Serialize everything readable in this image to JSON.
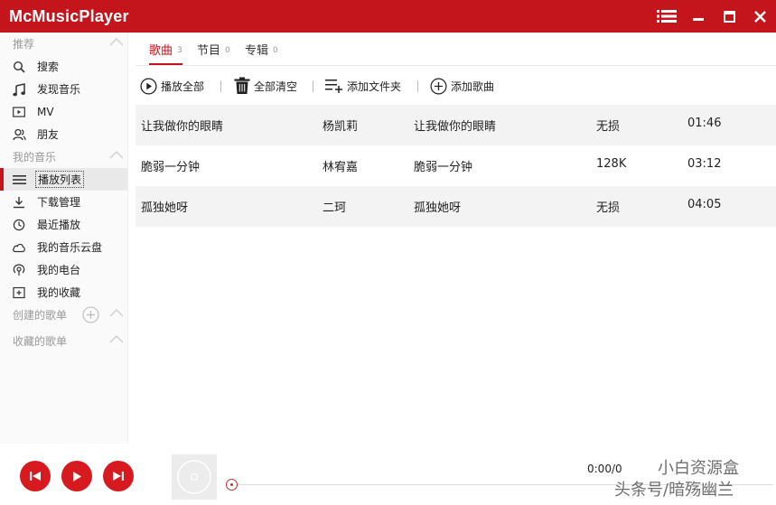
{
  "app": {
    "title": "McMusicPlayer",
    "accent": "#c4151c"
  },
  "sidebar": {
    "sections": {
      "recommend": "推荐",
      "my_music": "我的音乐",
      "created_playlists": "创建的歌单",
      "collected_playlists": "收藏的歌单"
    },
    "recommend_items": [
      {
        "label": "搜索",
        "icon": "search-icon"
      },
      {
        "label": "发现音乐",
        "icon": "music-note-icon"
      },
      {
        "label": "MV",
        "icon": "mv-icon"
      },
      {
        "label": "朋友",
        "icon": "friends-icon"
      }
    ],
    "music_items": [
      {
        "label": "播放列表",
        "icon": "playlist-icon"
      },
      {
        "label": "下载管理",
        "icon": "download-icon"
      },
      {
        "label": "最近播放",
        "icon": "clock-icon"
      },
      {
        "label": "我的音乐云盘",
        "icon": "cloud-icon"
      },
      {
        "label": "我的电台",
        "icon": "radio-icon"
      },
      {
        "label": "我的收藏",
        "icon": "collection-icon"
      }
    ]
  },
  "tabs": [
    {
      "label": "歌曲",
      "count": "3"
    },
    {
      "label": "节目",
      "count": "0"
    },
    {
      "label": "专辑",
      "count": "0"
    }
  ],
  "toolbar": {
    "play_all": "播放全部",
    "clear_all": "全部清空",
    "add_folder": "添加文件夹",
    "add_song": "添加歌曲"
  },
  "songs": [
    {
      "title": "让我做你的眼睛",
      "artist": "杨凯莉",
      "album": "让我做你的眼睛",
      "quality": "无损",
      "duration": "01:46"
    },
    {
      "title": "脆弱一分钟",
      "artist": "林宥嘉",
      "album": "脆弱一分钟",
      "quality": "128K",
      "duration": "03:12"
    },
    {
      "title": "孤独她呀",
      "artist": "二珂",
      "album": "孤独她呀",
      "quality": "无损",
      "duration": "04:05"
    }
  ],
  "player": {
    "time": "0:00/0",
    "progress": 0
  },
  "watermark": {
    "line1": "小白资源盒",
    "line2": "头条号/暗殇幽兰"
  }
}
